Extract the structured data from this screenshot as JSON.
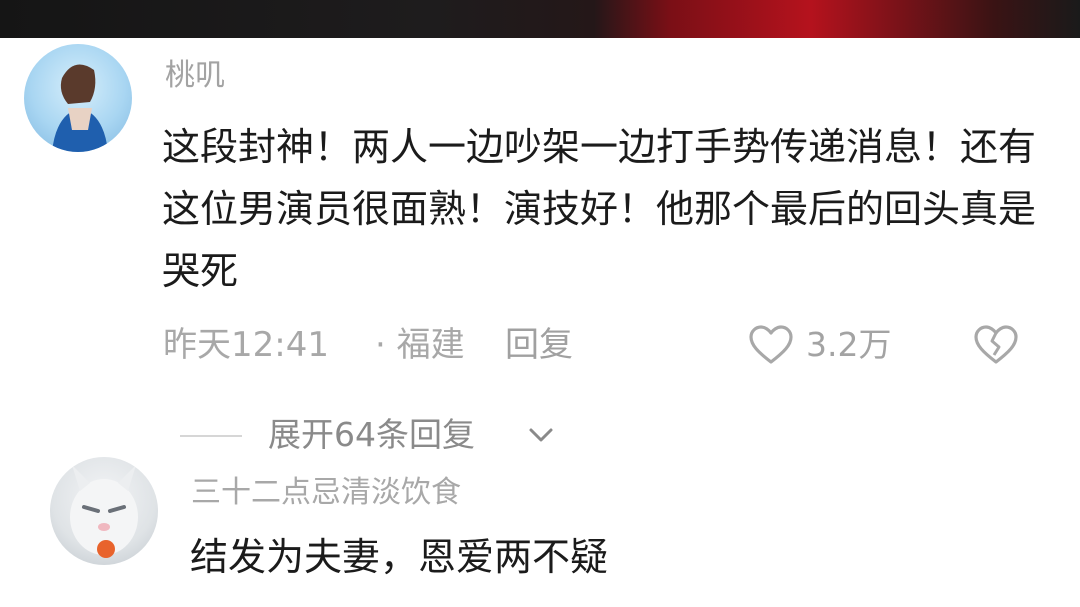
{
  "comments": [
    {
      "username": "桃叽",
      "text": "这段封神！两人一边吵架一边打手势传递消息！还有 这位男演员很面熟！演技好！他那个最后的回头真是哭死",
      "time": "昨天12:41",
      "region": "· 福建",
      "reply_label": "回复",
      "like_count": "3.2万",
      "like_icon": "heart-outline-icon",
      "dislike_icon": "broken-heart-icon"
    },
    {
      "username": "三十二点忌清淡饮食",
      "text": "结发为夫妻，恩爱两不疑"
    }
  ],
  "expand_replies_label": "展开64条回复",
  "colors": {
    "meta_text": "#a8a8a8",
    "body_text": "#1b1b1b",
    "background": "#ffffff"
  }
}
